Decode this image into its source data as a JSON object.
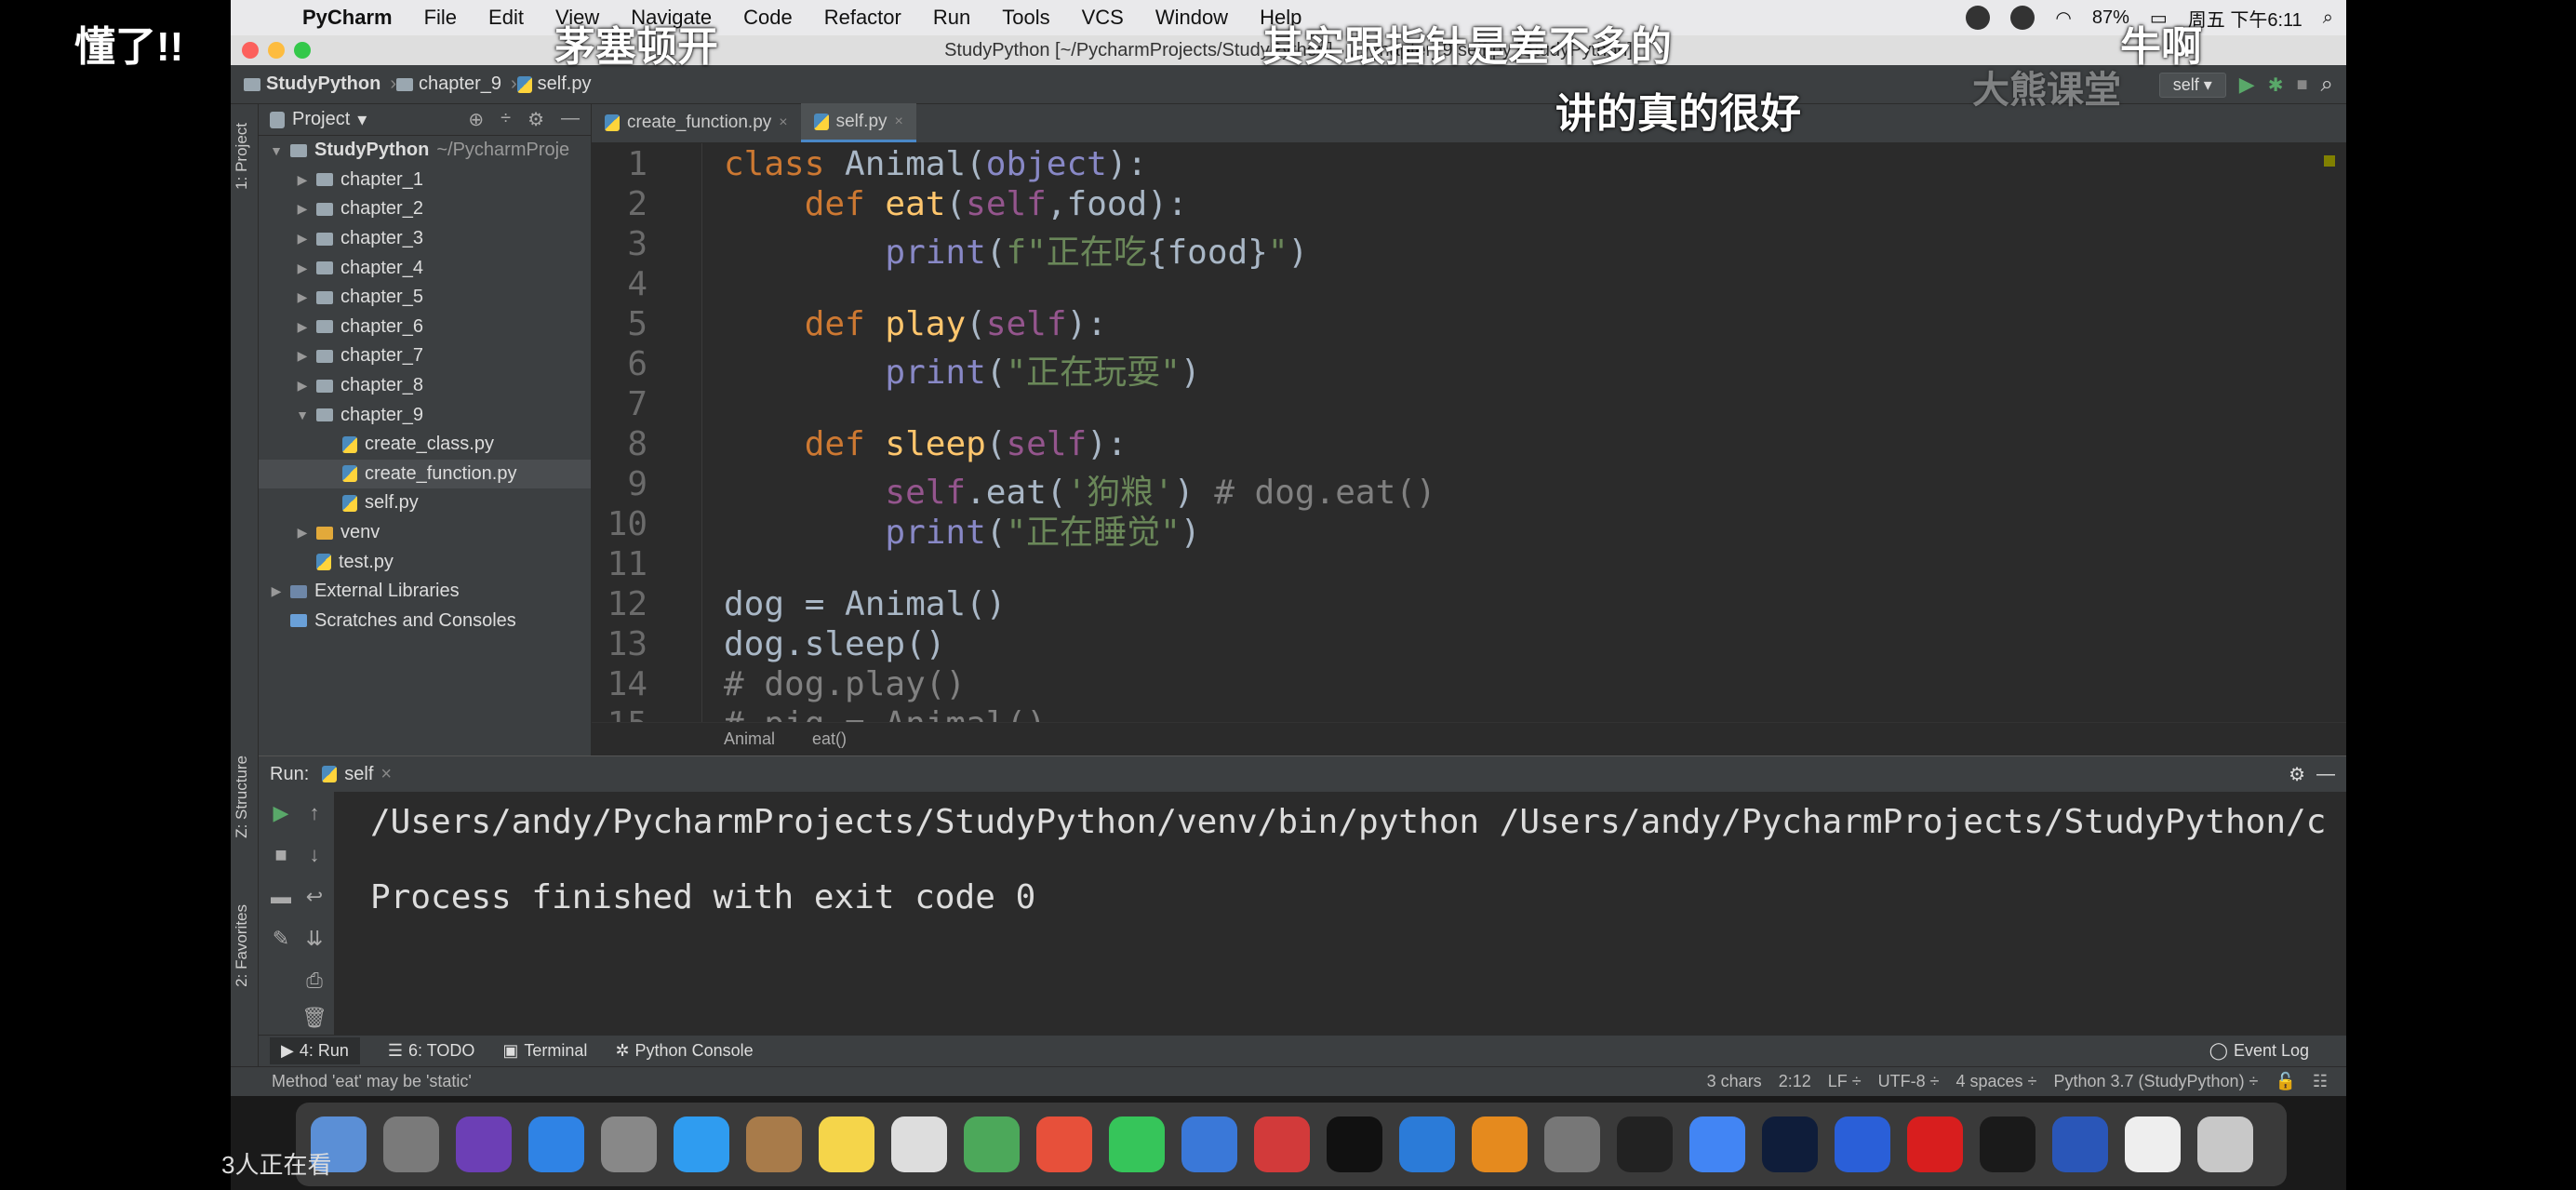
{
  "menubar": {
    "app": "PyCharm",
    "items": [
      "File",
      "Edit",
      "View",
      "Navigate",
      "Code",
      "Refactor",
      "Run",
      "Tools",
      "VCS",
      "Window",
      "Help"
    ],
    "battery": "87%",
    "clock": "周五 下午6:11"
  },
  "window": {
    "title": "StudyPython [~/PycharmProjects/StudyPython] - .../chapter_9/self.py [StudyPython]"
  },
  "navbar": {
    "crumbs": [
      "StudyPython",
      "chapter_9",
      "self.py"
    ],
    "run_config": "self"
  },
  "left_strip": {
    "project": "1: Project",
    "structure": "Z: Structure",
    "favorites": "2: Favorites"
  },
  "project": {
    "title": "Project",
    "tree": [
      {
        "label": "StudyPython",
        "extra": "~/PycharmProje",
        "indent": 0,
        "arrow": "▼",
        "type": "folder",
        "bold": true
      },
      {
        "label": "chapter_1",
        "indent": 1,
        "arrow": "▶",
        "type": "folder"
      },
      {
        "label": "chapter_2",
        "indent": 1,
        "arrow": "▶",
        "type": "folder"
      },
      {
        "label": "chapter_3",
        "indent": 1,
        "arrow": "▶",
        "type": "folder"
      },
      {
        "label": "chapter_4",
        "indent": 1,
        "arrow": "▶",
        "type": "folder"
      },
      {
        "label": "chapter_5",
        "indent": 1,
        "arrow": "▶",
        "type": "folder"
      },
      {
        "label": "chapter_6",
        "indent": 1,
        "arrow": "▶",
        "type": "folder"
      },
      {
        "label": "chapter_7",
        "indent": 1,
        "arrow": "▶",
        "type": "folder"
      },
      {
        "label": "chapter_8",
        "indent": 1,
        "arrow": "▶",
        "type": "folder"
      },
      {
        "label": "chapter_9",
        "indent": 1,
        "arrow": "▼",
        "type": "folder"
      },
      {
        "label": "create_class.py",
        "indent": 2,
        "arrow": "",
        "type": "py"
      },
      {
        "label": "create_function.py",
        "indent": 2,
        "arrow": "",
        "type": "py",
        "selected": true
      },
      {
        "label": "self.py",
        "indent": 2,
        "arrow": "",
        "type": "py"
      },
      {
        "label": "venv",
        "indent": 1,
        "arrow": "▶",
        "type": "venv"
      },
      {
        "label": "test.py",
        "indent": 1,
        "arrow": "",
        "type": "py"
      },
      {
        "label": "External Libraries",
        "indent": 0,
        "arrow": "▶",
        "type": "lib"
      },
      {
        "label": "Scratches and Consoles",
        "indent": 0,
        "arrow": "",
        "type": "scratch"
      }
    ]
  },
  "editor": {
    "tabs": [
      {
        "label": "create_function.py",
        "active": false
      },
      {
        "label": "self.py",
        "active": true
      }
    ],
    "lines": [
      {
        "n": "1",
        "html": "<span class='kw'>class</span> Animal(<span class='bi'>object</span>):"
      },
      {
        "n": "2",
        "html": "    <span class='kw'>def</span> <span class='fn'>eat</span>(<span class='sf'>self</span>,food):"
      },
      {
        "n": "3",
        "html": "        <span class='bi'>print</span>(<span class='st'>f\"正在吃</span>{food}<span class='st'>\"</span>)"
      },
      {
        "n": "4",
        "html": ""
      },
      {
        "n": "5",
        "html": "    <span class='kw'>def</span> <span class='fn'>play</span>(<span class='sf'>self</span>):"
      },
      {
        "n": "6",
        "html": "        <span class='bi'>print</span>(<span class='st'>\"正在玩耍\"</span>)"
      },
      {
        "n": "7",
        "html": ""
      },
      {
        "n": "8",
        "html": "    <span class='kw'>def</span> <span class='fn'>sleep</span>(<span class='sf'>self</span>):"
      },
      {
        "n": "9",
        "html": "        <span class='sf'>self</span>.eat(<span class='st'>'狗粮'</span>) <span class='cm'># dog.eat()</span>"
      },
      {
        "n": "10",
        "html": "        <span class='bi'>print</span>(<span class='st'>\"正在睡觉\"</span>)"
      },
      {
        "n": "11",
        "html": ""
      },
      {
        "n": "12",
        "html": "dog = Animal()"
      },
      {
        "n": "13",
        "html": "dog.sleep()"
      },
      {
        "n": "14",
        "html": "<span class='cm'># dog.play()</span>"
      },
      {
        "n": "15",
        "html": "<span class='cm'># pig = Animal()</span>"
      }
    ],
    "breadcrumb": [
      "Animal",
      "eat()"
    ]
  },
  "run": {
    "label": "Run:",
    "config": "self",
    "output": [
      "/Users/andy/PycharmProjects/StudyPython/venv/bin/python /Users/andy/PycharmProjects/StudyPython/chapte",
      "",
      "Process finished with exit code 0"
    ]
  },
  "bottom_tabs": [
    "4: Run",
    "6: TODO",
    "Terminal",
    "Python Console"
  ],
  "event_log": "Event Log",
  "status": {
    "message": "Method 'eat' may be 'static'",
    "chars": "3 chars",
    "pos": "2:12",
    "lf": "LF ÷",
    "enc": "UTF-8 ÷",
    "indent": "4 spaces ÷",
    "interp": "Python 3.7 (StudyPython) ÷"
  },
  "danmaku": {
    "d1": "懂了!!",
    "d2": "茅塞顿开",
    "d3": "其实跟指针是差不多的",
    "d4": "牛啊",
    "d5": "讲的真的很好",
    "d6": "大熊课堂"
  },
  "viewers": "3人正在看",
  "dock_colors": [
    "#5b8fd6",
    "#7a7a7a",
    "#6c3fb5",
    "#2f83e5",
    "#888",
    "#2f9cf0",
    "#a87b4a",
    "#f5d54a",
    "#ddd",
    "#4ca85a",
    "#e7503a",
    "#36c55a",
    "#3a78d8",
    "#d23a3a",
    "#111",
    "#2b7bd8",
    "#e58a1e",
    "#777",
    "#222",
    "#4285f4",
    "#0f1d3a",
    "#2a5fd8",
    "#d81e1e",
    "#1a1a1a",
    "#2a56b8",
    "#eee",
    "#c8c8c8"
  ]
}
